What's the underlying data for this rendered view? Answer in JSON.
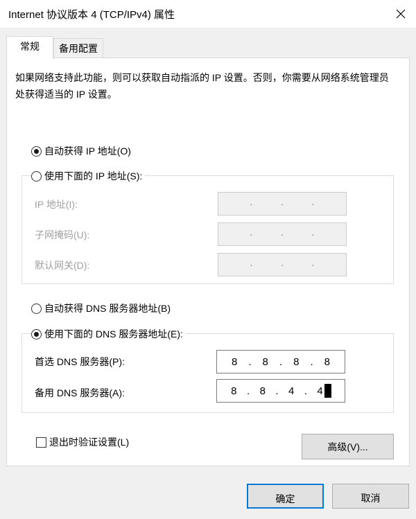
{
  "window": {
    "title": "Internet 协议版本 4 (TCP/IPv4) 属性"
  },
  "tabs": [
    {
      "label": "常规",
      "active": true
    },
    {
      "label": "备用配置",
      "active": false
    }
  ],
  "description": "如果网络支持此功能，则可以获取自动指派的 IP 设置。否则，你需要从网络系统管理员处获得适当的 IP 设置。",
  "ip_section": {
    "auto_label": "自动获得 IP 地址(O)",
    "auto_selected": true,
    "manual_label": "使用下面的 IP 地址(S):",
    "manual_selected": false,
    "fields": [
      {
        "label": "IP 地址(I):",
        "octets": [
          "",
          "",
          "",
          ""
        ],
        "enabled": false
      },
      {
        "label": "子网掩码(U):",
        "octets": [
          "",
          "",
          "",
          ""
        ],
        "enabled": false
      },
      {
        "label": "默认网关(D):",
        "octets": [
          "",
          "",
          "",
          ""
        ],
        "enabled": false
      }
    ]
  },
  "dns_section": {
    "auto_label": "自动获得 DNS 服务器地址(B)",
    "auto_selected": false,
    "manual_label": "使用下面的 DNS 服务器地址(E):",
    "manual_selected": true,
    "fields": [
      {
        "label": "首选 DNS 服务器(P):",
        "octets": [
          "8",
          "8",
          "8",
          "8"
        ],
        "enabled": true
      },
      {
        "label": "备用 DNS 服务器(A):",
        "octets": [
          "8",
          "8",
          "4",
          "4"
        ],
        "enabled": true
      }
    ]
  },
  "validate_checkbox": {
    "label": "退出时验证设置(L)",
    "checked": false
  },
  "buttons": {
    "advanced": "高级(V)...",
    "ok": "确定",
    "cancel": "取消"
  },
  "icons": {
    "close": "close-icon"
  }
}
